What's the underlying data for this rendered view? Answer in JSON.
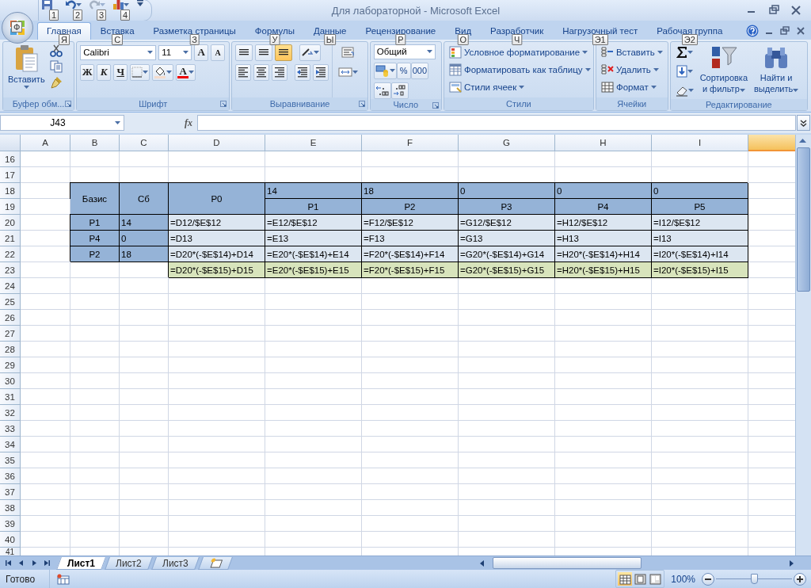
{
  "window": {
    "title": "Для лабораторной - Microsoft Excel",
    "office_keytip": "Ф"
  },
  "quick_access": [
    {
      "kind": "save",
      "keytip": "1",
      "disabled": false
    },
    {
      "kind": "undo",
      "keytip": "2",
      "disabled": false
    },
    {
      "kind": "redo",
      "keytip": "3",
      "disabled": true
    },
    {
      "kind": "chart",
      "keytip": "4",
      "disabled": false
    }
  ],
  "ribbon_tabs": [
    {
      "label": "Главная",
      "keytip": "Я",
      "selected": true
    },
    {
      "label": "Вставка",
      "keytip": "С",
      "selected": false
    },
    {
      "label": "Разметка страницы",
      "keytip": "З",
      "selected": false
    },
    {
      "label": "Формулы",
      "keytip": "У",
      "selected": false
    },
    {
      "label": "Данные",
      "keytip": "Ы",
      "selected": false
    },
    {
      "label": "Рецензирование",
      "keytip": "Р",
      "selected": false
    },
    {
      "label": "Вид",
      "keytip": "О",
      "selected": false
    },
    {
      "label": "Разработчик",
      "keytip": "Ч",
      "selected": false
    },
    {
      "label": "Нагрузочный тест",
      "keytip": "Э1",
      "selected": false
    },
    {
      "label": "Рабочая группа",
      "keytip": "Э2",
      "selected": false
    }
  ],
  "ribbon_groups": [
    {
      "kind": "clipboard",
      "title": "Буфер обм...",
      "paste": "Вставить"
    },
    {
      "kind": "font",
      "title": "Шрифт",
      "font_name": "Calibri",
      "font_size": "11",
      "grow": "A",
      "shrink": "A",
      "bold": "Ж",
      "italic": "К",
      "underline": "Ч",
      "font_color": "A"
    },
    {
      "kind": "alignment",
      "title": "Выравнивание",
      "vertical_align": [
        {
          "selected": false
        },
        {
          "selected": false
        },
        {
          "selected": true
        }
      ]
    },
    {
      "kind": "number",
      "title": "Число",
      "format": "Общий",
      "percent": "%",
      "thousands": "000"
    },
    {
      "kind": "styles",
      "title": "Стили",
      "items": [
        "Условное форматирование",
        "Форматировать как таблицу",
        "Стили ячеек"
      ]
    },
    {
      "kind": "cells",
      "title": "Ячейки",
      "items": [
        "Вставить",
        "Удалить",
        "Формат"
      ]
    },
    {
      "kind": "editing",
      "title": "Редактирование",
      "sort": [
        "Сортировка",
        "и фильтр"
      ],
      "find": [
        "Найти и",
        "выделить"
      ]
    }
  ],
  "formula_bar": {
    "name_box": "J43",
    "fx": "fx"
  },
  "sheet": {
    "columns": [
      {
        "label": "A",
        "selected": false
      },
      {
        "label": "B",
        "selected": false
      },
      {
        "label": "C",
        "selected": false
      },
      {
        "label": "D",
        "selected": false
      },
      {
        "label": "E",
        "selected": false
      },
      {
        "label": "F",
        "selected": false
      },
      {
        "label": "G",
        "selected": false
      },
      {
        "label": "H",
        "selected": false
      },
      {
        "label": "I",
        "selected": false
      },
      {
        "selected": true
      }
    ],
    "rows": [
      {
        "number": "16"
      },
      {
        "number": "17"
      },
      {
        "number": "18",
        "cells": [
          null,
          {
            "text": "Базис",
            "kind": "tall_label"
          },
          {
            "text": "Сб",
            "kind": "tall_label"
          },
          {
            "text": "P0",
            "kind": "tall_label"
          },
          {
            "text": "14",
            "kind": "header"
          },
          {
            "text": "18",
            "kind": "header"
          },
          {
            "text": "0",
            "kind": "header"
          },
          {
            "text": "0",
            "kind": "header"
          },
          {
            "text": "0",
            "kind": "header"
          },
          null
        ]
      },
      {
        "number": "19",
        "cells": [
          null,
          null,
          null,
          null,
          {
            "text": "P1",
            "kind": "label"
          },
          {
            "text": "P2",
            "kind": "label"
          },
          {
            "text": "P3",
            "kind": "label"
          },
          {
            "text": "P4",
            "kind": "label"
          },
          {
            "text": "P5",
            "kind": "label"
          },
          null
        ]
      },
      {
        "number": "20",
        "cells": [
          null,
          {
            "text": "P1",
            "kind": "label"
          },
          {
            "text": "14",
            "kind": "header"
          },
          {
            "text": "=D12/$E$12",
            "kind": "value"
          },
          {
            "text": "=E12/$E$12",
            "kind": "value"
          },
          {
            "text": "=F12/$E$12",
            "kind": "value"
          },
          {
            "text": "=G12/$E$12",
            "kind": "value"
          },
          {
            "text": "=H12/$E$12",
            "kind": "value"
          },
          {
            "text": "=I12/$E$12",
            "kind": "value"
          },
          null
        ]
      },
      {
        "number": "21",
        "cells": [
          null,
          {
            "text": "P4",
            "kind": "label"
          },
          {
            "text": "0",
            "kind": "header"
          },
          {
            "text": "=D13",
            "kind": "value"
          },
          {
            "text": "=E13",
            "kind": "value"
          },
          {
            "text": "=F13",
            "kind": "value"
          },
          {
            "text": "=G13",
            "kind": "value"
          },
          {
            "text": "=H13",
            "kind": "value"
          },
          {
            "text": "=I13",
            "kind": "value"
          },
          null
        ]
      },
      {
        "number": "22",
        "cells": [
          null,
          {
            "text": "P2",
            "kind": "label"
          },
          {
            "text": "18",
            "kind": "header"
          },
          {
            "text": "=D20*(-$E$14)+D14",
            "kind": "value"
          },
          {
            "text": "=E20*(-$E$14)+E14",
            "kind": "value"
          },
          {
            "text": "=F20*(-$E$14)+F14",
            "kind": "value"
          },
          {
            "text": "=G20*(-$E$14)+G14",
            "kind": "value"
          },
          {
            "text": "=H20*(-$E$14)+H14",
            "kind": "value"
          },
          {
            "text": "=I20*(-$E$14)+I14",
            "kind": "value"
          },
          null
        ]
      },
      {
        "number": "23",
        "cells": [
          null,
          null,
          null,
          {
            "text": "=D20*(-$E$15)+D15",
            "kind": "total"
          },
          {
            "text": "=E20*(-$E$15)+E15",
            "kind": "total"
          },
          {
            "text": "=F20*(-$E$15)+F15",
            "kind": "total"
          },
          {
            "text": "=G20*(-$E$15)+G15",
            "kind": "total"
          },
          {
            "text": "=H20*(-$E$15)+H15",
            "kind": "total"
          },
          {
            "text": "=I20*(-$E$15)+I15",
            "kind": "total"
          },
          null
        ]
      },
      {
        "number": "24"
      },
      {
        "number": "25"
      },
      {
        "number": "26"
      },
      {
        "number": "27"
      },
      {
        "number": "28"
      },
      {
        "number": "29"
      },
      {
        "number": "30"
      },
      {
        "number": "31"
      },
      {
        "number": "32"
      },
      {
        "number": "33"
      },
      {
        "number": "34"
      },
      {
        "number": "35"
      },
      {
        "number": "36"
      },
      {
        "number": "37"
      },
      {
        "number": "38"
      },
      {
        "number": "39"
      },
      {
        "number": "40"
      },
      {
        "number": "41"
      }
    ]
  },
  "sheet_tabs": [
    {
      "label": "Лист1",
      "selected": true
    },
    {
      "label": "Лист2",
      "selected": false
    },
    {
      "label": "Лист3",
      "selected": false
    }
  ],
  "status_bar": {
    "status": "Готово",
    "views": [
      {
        "selected": true
      },
      {
        "selected": false
      },
      {
        "selected": false
      }
    ],
    "zoom": "100%",
    "zoom_slider": {
      "level": 0.5
    }
  }
}
